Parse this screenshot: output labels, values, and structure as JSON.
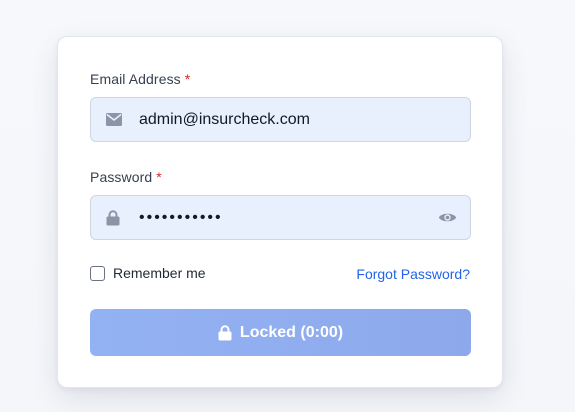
{
  "login_form": {
    "email": {
      "label": "Email Address",
      "required_mark": "*",
      "value": "admin@insurcheck.com",
      "icon": "envelope-icon"
    },
    "password": {
      "label": "Password",
      "required_mark": "*",
      "value_masked": "•••••••••••",
      "icon": "lock-icon",
      "toggle_icon": "eye-icon"
    },
    "remember_me": {
      "label": "Remember me",
      "checked": false
    },
    "forgot_password_label": "Forgot Password?",
    "submit_button": {
      "label": "Locked (0:00)",
      "icon": "lock-icon",
      "disabled": true
    }
  },
  "colors": {
    "accent_link": "#2563eb",
    "required": "#dc2626",
    "input_bg": "#e8f0fe",
    "button_disabled_bg": "#93b2f3"
  }
}
